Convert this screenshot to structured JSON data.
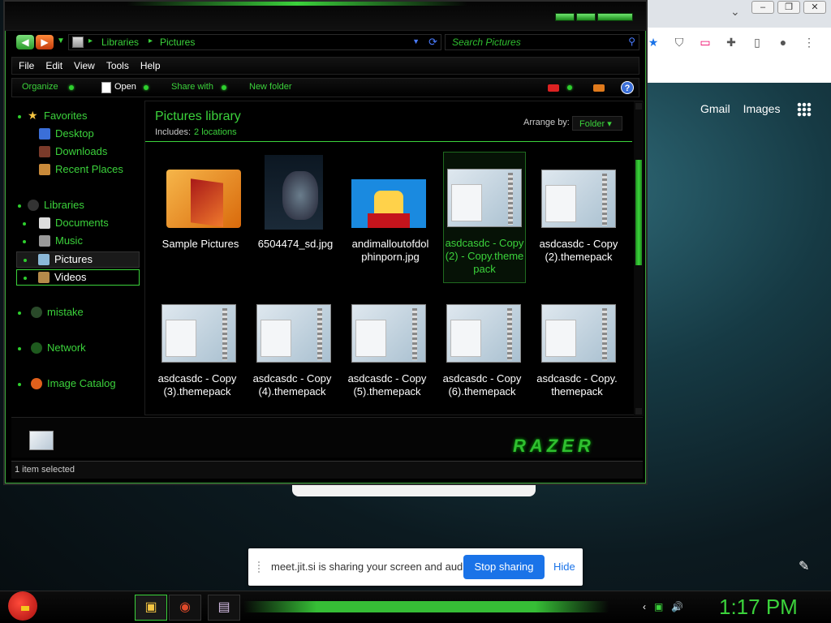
{
  "window": {
    "breadcrumb": [
      "Libraries",
      "Pictures"
    ],
    "search_placeholder": "Search Pictures",
    "menu": [
      "File",
      "Edit",
      "View",
      "Tools",
      "Help"
    ],
    "toolbar": {
      "organize": "Organize",
      "open": "Open",
      "share_with": "Share with",
      "new_folder": "New folder",
      "help": "?"
    },
    "nav": {
      "favorites": "Favorites",
      "desktop": "Desktop",
      "downloads": "Downloads",
      "recent_places": "Recent Places",
      "libraries": "Libraries",
      "documents": "Documents",
      "music": "Music",
      "pictures": "Pictures",
      "videos": "Videos",
      "mistake": "mistake",
      "network": "Network",
      "image_catalog": "Image Catalog"
    },
    "library": {
      "title": "Pictures library",
      "includes_label": "Includes:",
      "locations": "2 locations",
      "arrange_label": "Arrange by:",
      "arrange_value": "Folder"
    },
    "files": [
      {
        "name": "Sample Pictures",
        "type": "folder"
      },
      {
        "name": "6504474_sd.jpg",
        "type": "poster"
      },
      {
        "name": "andimalloutofdolphinporn.jpg",
        "type": "comic"
      },
      {
        "name": "asdcasdc - Copy (2) - Copy.themepack",
        "type": "themepack",
        "selected": true
      },
      {
        "name": "asdcasdc - Copy (2).themepack",
        "type": "themepack"
      },
      {
        "name": "asdcasdc - Copy (3).themepack",
        "type": "themepack"
      },
      {
        "name": "asdcasdc - Copy (4).themepack",
        "type": "themepack"
      },
      {
        "name": "asdcasdc - Copy (5).themepack",
        "type": "themepack"
      },
      {
        "name": "asdcasdc - Copy (6).themepack",
        "type": "themepack"
      },
      {
        "name": "asdcasdc - Copy.themepack",
        "type": "themepack"
      }
    ],
    "status": "1 item selected",
    "brand": "RAZER"
  },
  "browser": {
    "links": [
      "Gmail",
      "Images"
    ],
    "window_buttons": [
      "–",
      "❐",
      "✕"
    ]
  },
  "share_bar": {
    "message": "meet.jit.si is sharing your screen and audio.",
    "stop": "Stop sharing",
    "hide": "Hide"
  },
  "taskbar": {
    "clock": "1:17 PM"
  },
  "colors": {
    "accent": "#3bd23b",
    "background": "#000000",
    "share_button": "#1a73e8"
  }
}
